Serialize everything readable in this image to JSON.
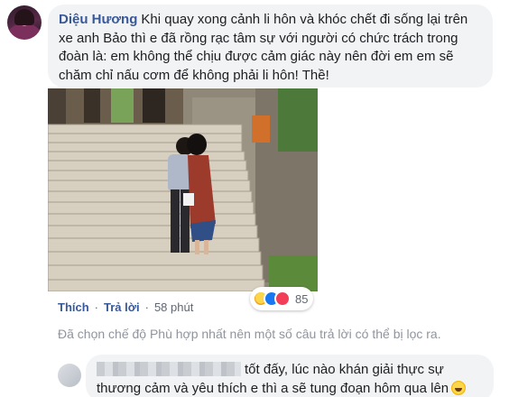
{
  "comment1": {
    "author": "Diệu Hương",
    "text": "Khi quay xong cảnh li hôn và khóc chết đi sống lại trên xe anh Bảo thì e đã rồng rạc tâm sự với người có chức trách trong đoàn là: em không thể chịu được cảm giác này nên đời em em sẽ chăm chỉ nấu cơm để không phải li hôn! Thề!",
    "reactions": {
      "count": "85",
      "icons": [
        "haha-icon",
        "like-icon",
        "love-icon"
      ]
    },
    "actions": {
      "like": "Thích",
      "reply": "Trả lời",
      "time": "58 phút"
    }
  },
  "filter_note": "Đã chọn chế độ Phù hợp nhất nên một số câu trả lời có thể bị lọc ra.",
  "comment2": {
    "text": "tốt đấy, lúc nào khán giải thực sự thương cảm và yêu thích e thì a sẽ tung đoạn hôm qua lên"
  },
  "colors": {
    "author_link": "#385898",
    "bubble_bg": "#f2f3f5",
    "meta_text": "#606770",
    "note_text": "#90949c"
  }
}
